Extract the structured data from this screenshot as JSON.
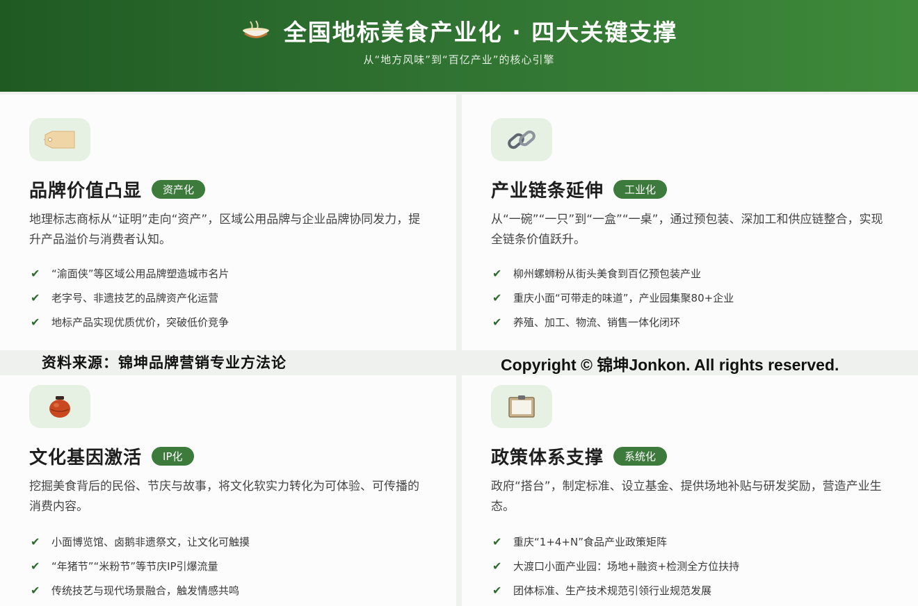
{
  "header": {
    "icon": "bowl-icon",
    "title": "全国地标美食产业化 · 四大关键支撑",
    "subtitle": "从“地方风味”到“百亿产业”的核心引擎"
  },
  "cards": [
    {
      "icon": "price-tag-icon",
      "title": "品牌价值凸显",
      "badge": "资产化",
      "desc": "地理标志商标从“证明”走向“资产”，区域公用品牌与企业品牌协同发力，提升产品溢价与消费者认知。",
      "items": [
        "“渝面侠”等区域公用品牌塑造城市名片",
        "老字号、非遗技艺的品牌资产化运营",
        "地标产品实现优质优价，突破低价竞争"
      ]
    },
    {
      "icon": "chain-link-icon",
      "title": "产业链条延伸",
      "badge": "工业化",
      "desc": "从“一碗”“一只”到“一盒”“一桌”，通过预包装、深加工和供应链整合，实现全链条价值跃升。",
      "items": [
        "柳州螺蛳粉从街头美食到百亿预包装产业",
        "重庆小面“可带走的味道”，产业园集聚80+企业",
        "养殖、加工、物流、销售一体化闭环"
      ]
    },
    {
      "icon": "clay-jar-icon",
      "title": "文化基因激活",
      "badge": "IP化",
      "desc": "挖掘美食背后的民俗、节庆与故事，将文化软实力转化为可体验、可传播的消费内容。",
      "items": [
        "小面博览馆、卤鹅非遗祭文，让文化可触摸",
        "“年猪节”“米粉节”等节庆IP引爆流量",
        "传统技艺与现代场景融合，触发情感共鸣"
      ]
    },
    {
      "icon": "clipboard-icon",
      "title": "政策体系支撑",
      "badge": "系统化",
      "desc": "政府“搭台”，制定标准、设立基金、提供场地补贴与研发奖励，营造产业生态。",
      "items": [
        "重庆“1+4+N”食品产业政策矩阵",
        "大渡口小面产业园：场地+融资+检测全方位扶持",
        "团体标准、生产技术规范引领行业规范发展"
      ]
    }
  ],
  "check_glyph": "✔",
  "watermarks": {
    "left": "资料来源：锦坤品牌营销专业方法论",
    "right": "Copyright © 锦坤Jonkon. All rights reserved."
  },
  "colors": {
    "header_dark": "#1f5a23",
    "header_light": "#3e8a3a",
    "badge": "#3d7b3c",
    "icon_bg": "#e6f1e4"
  }
}
